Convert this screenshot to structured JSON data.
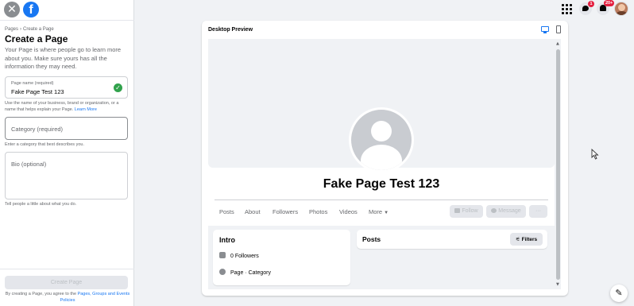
{
  "sidebar": {
    "breadcrumb": [
      "Pages",
      "Create a Page"
    ],
    "breadcrumb_sep": "›",
    "title": "Create a Page",
    "description": "Your Page is where people go to learn more about you. Make sure yours has all the information they may need.",
    "page_name_field": {
      "label": "Page name (required)",
      "value": "Fake Page Test 123",
      "help": "Use the name of your business, brand or organization, or a name that helps explain your Page.",
      "help_link": "Learn More"
    },
    "category_field": {
      "placeholder": "Category (required)",
      "help": "Enter a category that best describes you."
    },
    "bio_field": {
      "placeholder": "Bio (optional)",
      "help": "Tell people a little about what you do."
    },
    "create_button": "Create Page",
    "legal_text": "By creating a Page, you agree to the",
    "legal_link": "Pages, Groups and Events Policies"
  },
  "topbar": {
    "messenger_badge": "1",
    "notifications_badge": "20+"
  },
  "preview": {
    "title": "Desktop Preview",
    "page_name": "Fake Page Test 123",
    "tabs": [
      "Posts",
      "About",
      "Followers",
      "Photos",
      "Videos",
      "More"
    ],
    "follow_button": "Follow",
    "message_button": "Message",
    "more_button": "···",
    "intro": {
      "title": "Intro",
      "followers": "0 Followers",
      "category": "Page · Category"
    },
    "posts": {
      "title": "Posts",
      "filters_button": "Filters"
    }
  },
  "colors": {
    "brand": "#1877f2",
    "success": "#31a24c",
    "badge": "#e41e3f"
  },
  "icons": [
    "close-icon",
    "facebook-logo",
    "check-icon",
    "menu-grid-icon",
    "messenger-icon",
    "bell-icon",
    "avatar",
    "desktop-icon",
    "mobile-icon",
    "filters-icon",
    "edit-icon"
  ]
}
